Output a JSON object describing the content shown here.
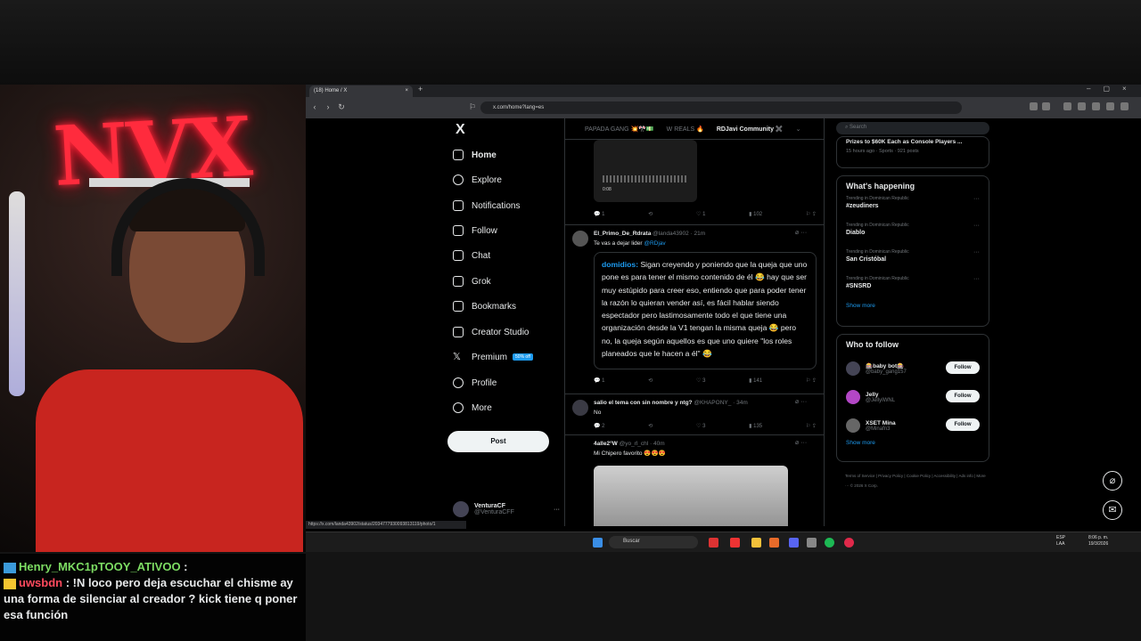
{
  "browser": {
    "tab_title": "(18) Home / X",
    "url": "x.com/home?lang=es",
    "status_link": "https://x.com/landa43902/status/2034777930093813119/photo/1"
  },
  "sidebar": {
    "logo": "X",
    "items": [
      {
        "label": "Home",
        "icon": "home-icon"
      },
      {
        "label": "Explore",
        "icon": "search-icon"
      },
      {
        "label": "Notifications",
        "icon": "bell-icon"
      },
      {
        "label": "Follow",
        "icon": "add-user-icon"
      },
      {
        "label": "Chat",
        "icon": "mail-icon"
      },
      {
        "label": "Grok",
        "icon": "grok-icon"
      },
      {
        "label": "Bookmarks",
        "icon": "bookmark-icon"
      },
      {
        "label": "Creator Studio",
        "icon": "rocket-icon"
      },
      {
        "label": "Premium",
        "icon": "x-icon"
      },
      {
        "label": "Profile",
        "icon": "person-icon"
      },
      {
        "label": "More",
        "icon": "more-circle-icon"
      }
    ],
    "premium_badge": "50% off",
    "post_label": "Post",
    "profile_name": "VenturaCF",
    "profile_handle": "@VenturaCFF"
  },
  "feed": {
    "tabs": [
      "PAPADA GANG 💥🎌💵",
      "W REALS 🔥",
      "RDJavi Community ✖️"
    ],
    "tweet1_stats": {
      "reply": "1",
      "retweet": "",
      "like": "1",
      "views": "102"
    },
    "tweet1_media_time": "0:08",
    "tweet2": {
      "name": "El_Primo_De_Rdrata",
      "handle": "@landa43902 · 21m",
      "text": "Te vas a dejar lider",
      "mention": "@RDjav",
      "quote_mention": "domidios:",
      "quote_text": "Sigan creyendo y poniendo que la queja que uno pone es para tener el mismo contenido de él 😂 hay que ser muy estúpido para creer eso, entiendo que para poder tener la razón lo quieran vender así, es fácil hablar siendo espectador pero lastimosamente todo el que tiene una organización desde la V1 tengan la misma queja 😂 pero no, la queja según aquellos es que uno quiere \"los roles planeados que le hacen a él\" 😂",
      "stats": {
        "reply": "1",
        "retweet": "",
        "like": "3",
        "views": "141"
      }
    },
    "tweet3": {
      "name": "salio el tema con sin nombre y ntg?",
      "handle": "@KHAPONY_ · 34m",
      "text": "No",
      "stats": {
        "reply": "2",
        "retweet": "",
        "like": "3",
        "views": "135"
      }
    },
    "tweet4": {
      "name": "4alle2°W",
      "handle": "@yo_rl_chl · 40m",
      "text": "Mi Chipero favorito 😍😍😍"
    }
  },
  "right": {
    "search_placeholder": "Search",
    "top_story": "Prizes to $60K Each as Console Players ...",
    "top_story_meta": "15 hours ago · Sports · 921 posts",
    "happening_title": "What's happening",
    "trends": [
      {
        "context": "Trending in Dominican Republic",
        "name": "#zeudiners"
      },
      {
        "context": "Trending in Dominican Republic",
        "name": "Diablo"
      },
      {
        "context": "Trending in Dominican Republic",
        "name": "San Cristóbal"
      },
      {
        "context": "Trending in Dominican Republic",
        "name": "#SNSRD"
      }
    ],
    "show_more": "Show more",
    "wtf_title": "Who to follow",
    "follow_label": "Follow",
    "suggestions": [
      {
        "name": "🎰baby bot🎰",
        "handle": "@baby_gang157"
      },
      {
        "name": "Jelly",
        "handle": "@JellyIWNL"
      },
      {
        "name": "XSET Mina",
        "handle": "@Minafn3"
      }
    ],
    "footer": "Terms of Service | Privacy Policy | Cookie Policy | Accessibility | Ads info | More ··· © 2026 X Corp."
  },
  "taskbar": {
    "search": "Buscar",
    "lang": "ESP LAA",
    "time": "8:06 p. m.",
    "date": "19/3/2026"
  },
  "chat": [
    {
      "user": "Henry_MKC1pTOOY_ATIVOO",
      "message": ""
    },
    {
      "user": "uwsbdn",
      "message": "!N loco pero deja escuchar el chisme ay una forma de silenciar al creador ? kick tiene q poner esa función"
    }
  ],
  "colors": {
    "accent": "#1d9bf0",
    "neon": "#ff2b3d",
    "chat_green": "#7ddc63",
    "chat_red": "#ff4a5e"
  }
}
